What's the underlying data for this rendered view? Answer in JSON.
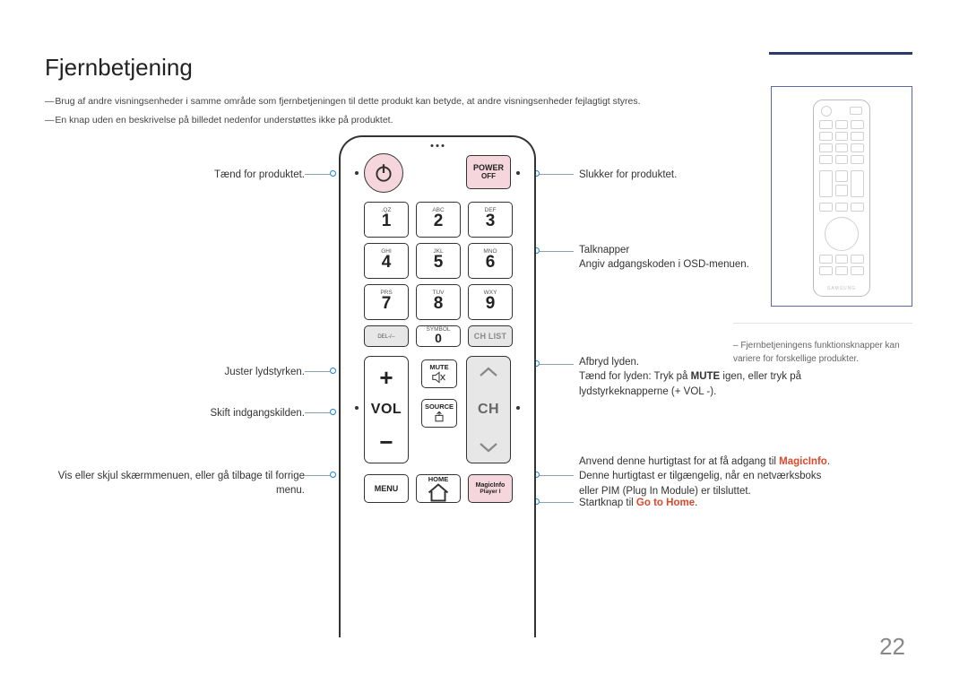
{
  "title": "Fjernbetjening",
  "notes": [
    "Brug af andre visningsenheder i samme område som fjernbetjeningen til dette produkt kan betyde, at andre visningsenheder fejlagtigt styres.",
    "En knap uden en beskrivelse på billedet nedenfor understøttes ikke på produktet."
  ],
  "labels": {
    "power_on": "Tænd for produktet.",
    "power_off": "Slukker for produktet.",
    "numbers_1": "Talknapper",
    "numbers_2": "Angiv adgangskoden i OSD-menuen.",
    "volume": "Juster lydstyrken.",
    "source": "Skift indgangskilden.",
    "menu": "Vis eller skjul skærmmenuen, eller gå tilbage til forrige menu.",
    "mute_1": "Afbryd lyden.",
    "mute_2_pre": "Tænd for lyden: Tryk på ",
    "mute_2_bold": "MUTE",
    "mute_2_post": " igen, eller tryk på lydstyrkeknapperne (+ VOL -).",
    "magic_1": "Anvend denne hurtigtast for at få adgang til ",
    "magic_bold": "MagicInfo",
    "magic_2": ". Denne hurtigtast er tilgængelig, når en netværksboks eller PIM (Plug In Module) er tilsluttet.",
    "home_pre": "Startknap til ",
    "home_bold": "Go to Home",
    "home_post": "."
  },
  "remote": {
    "power_off_1": "POWER",
    "power_off_2": "OFF",
    "keys": [
      {
        "sub": ".QZ",
        "big": "1"
      },
      {
        "sub": "ABC",
        "big": "2"
      },
      {
        "sub": "DEF",
        "big": "3"
      },
      {
        "sub": "GHI",
        "big": "4"
      },
      {
        "sub": "JKL",
        "big": "5"
      },
      {
        "sub": "MNO",
        "big": "6"
      },
      {
        "sub": "PRS",
        "big": "7"
      },
      {
        "sub": "TUV",
        "big": "8"
      },
      {
        "sub": "WXY",
        "big": "9"
      }
    ],
    "del": "DEL-/--",
    "symbol": "SYMBOL",
    "zero": "0",
    "chlist": "CH LIST",
    "vol": "VOL",
    "ch": "CH",
    "mute": "MUTE",
    "source": "SOURCE",
    "menu": "MENU",
    "home": "HOME",
    "magic1": "MagicInfo",
    "magic2": "Player I"
  },
  "side_note": "Fjernbetjeningens funktionsknapper kan variere for forskellige produkter.",
  "thumb_brand": "SAMSUNG",
  "page_number": "22"
}
